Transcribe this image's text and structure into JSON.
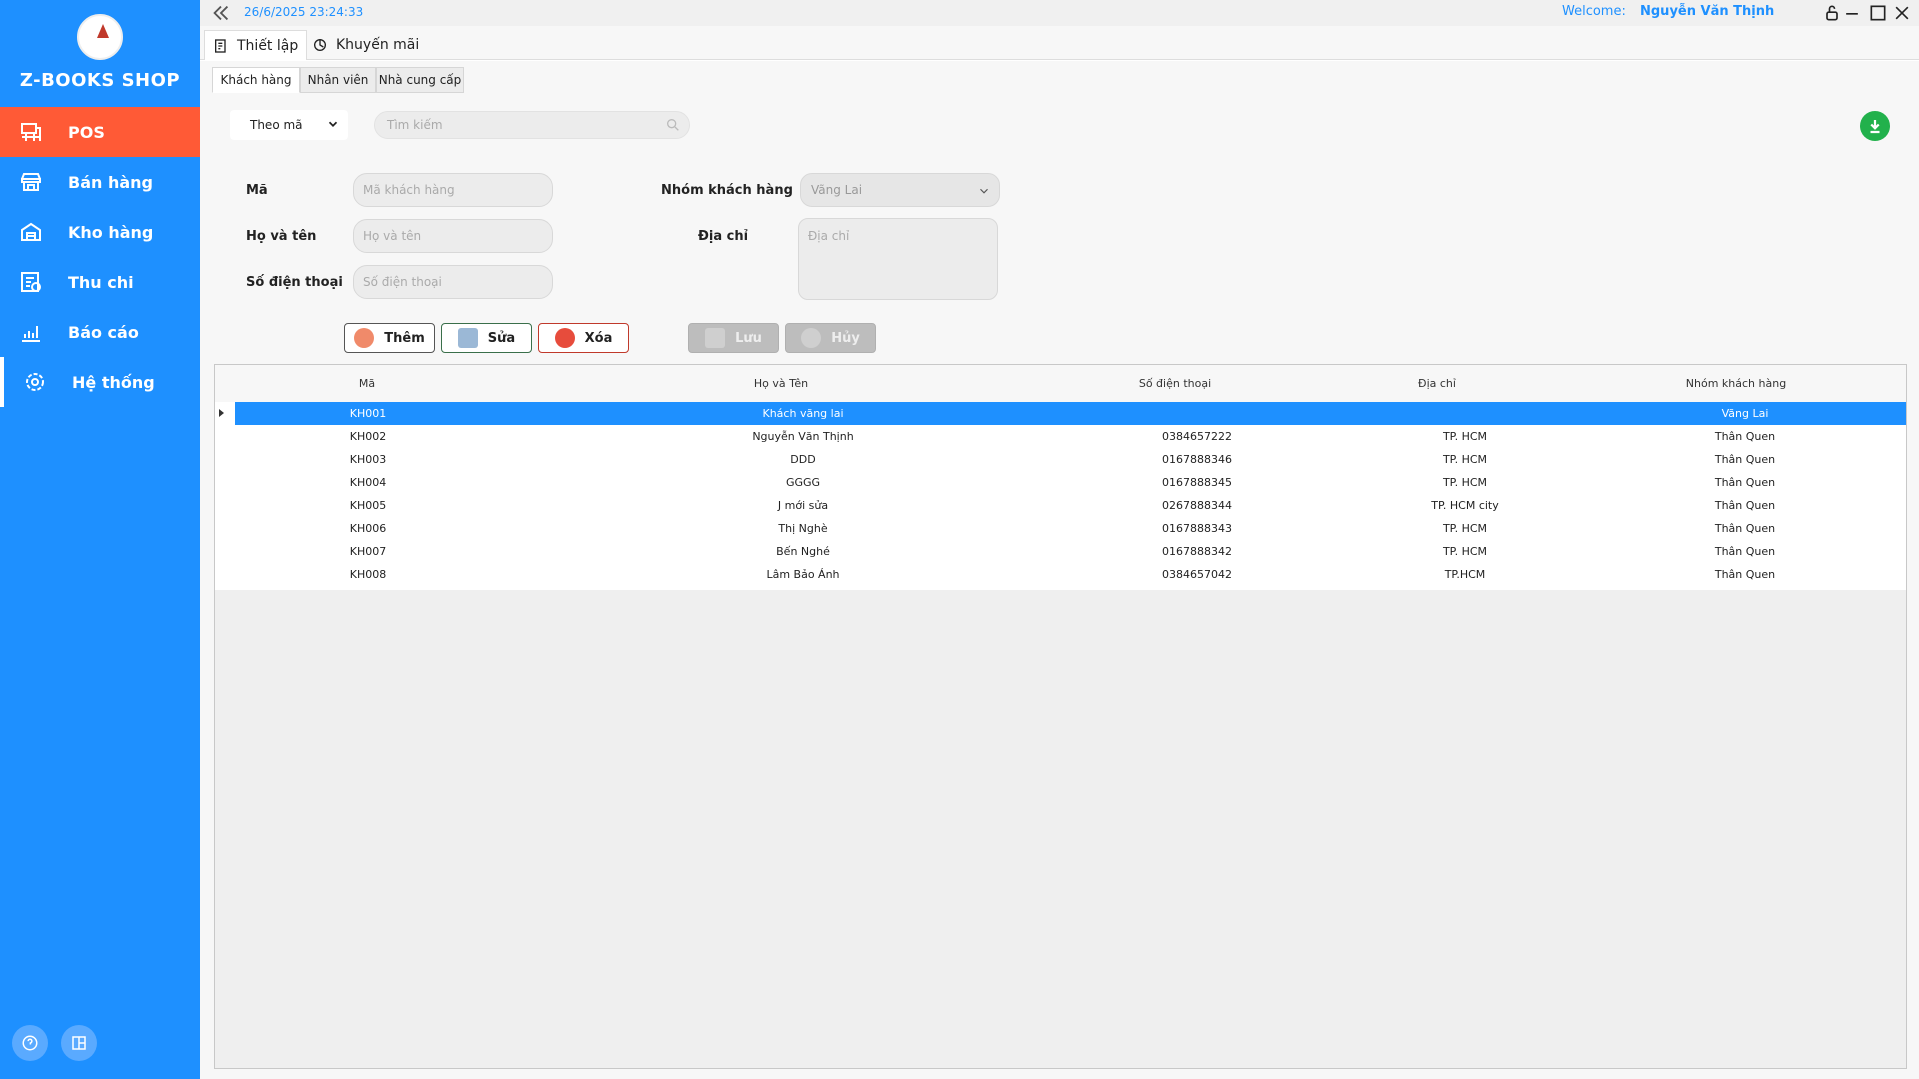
{
  "app": {
    "shop_name": "Z-BOOKS SHOP",
    "datetime": "26/6/2025 23:24:33",
    "welcome_label": "Welcome:",
    "user_name": "Nguyễn Văn Thịnh"
  },
  "colors": {
    "sidebar": "#1e90ff",
    "active_nav": "#ff5a36",
    "selected_row": "#1e90ff",
    "download": "#22b14c"
  },
  "sidebar": {
    "items": [
      {
        "label": "POS",
        "icon": "pos-icon"
      },
      {
        "label": "Bán hàng",
        "icon": "store-icon"
      },
      {
        "label": "Kho hàng",
        "icon": "warehouse-icon"
      },
      {
        "label": "Thu chi",
        "icon": "finance-icon"
      },
      {
        "label": "Báo cáo",
        "icon": "report-chart-icon"
      },
      {
        "label": "Hệ thống",
        "icon": "gear-icon"
      }
    ],
    "bottom": [
      "help-icon",
      "layout-icon"
    ]
  },
  "module_tabs": [
    {
      "label": "Thiết lập",
      "icon": "settings-doc-icon"
    },
    {
      "label": "Khuyến mãi",
      "icon": "promo-icon"
    }
  ],
  "sub_tabs": [
    "Khách hàng",
    "Nhân viên",
    "Nhà cung cấp"
  ],
  "filter": {
    "selected": "Theo mã",
    "search_placeholder": "Tìm kiếm"
  },
  "form": {
    "code_label": "Mã",
    "code_placeholder": "Mã khách hàng",
    "name_label": "Họ và tên",
    "name_placeholder": "Họ và tên",
    "phone_label": "Số điện thoại",
    "phone_placeholder": "Số điện thoại",
    "group_label": "Nhóm khách hàng",
    "group_value": "Vãng Lai",
    "address_label": "Địa chỉ",
    "address_placeholder": "Địa chỉ"
  },
  "buttons": {
    "add": "Thêm",
    "edit": "Sửa",
    "delete": "Xóa",
    "save": "Lưu",
    "cancel": "Hủy"
  },
  "table": {
    "columns": [
      "Mã",
      "Họ và Tên",
      "Số điện thoại",
      "Địa chỉ",
      "Nhóm khách hàng"
    ],
    "rows": [
      {
        "code": "KH001",
        "name": "Khách vãng lai",
        "phone": "",
        "address": "",
        "group": "Vãng Lai",
        "selected": true
      },
      {
        "code": "KH002",
        "name": "Nguyễn Văn Thịnh",
        "phone": "0384657222",
        "address": "TP. HCM",
        "group": "Thân Quen"
      },
      {
        "code": "KH003",
        "name": "DDD",
        "phone": "0167888346",
        "address": "TP. HCM",
        "group": "Thân Quen"
      },
      {
        "code": "KH004",
        "name": "GGGG",
        "phone": "0167888345",
        "address": "TP. HCM",
        "group": "Thân Quen"
      },
      {
        "code": "KH005",
        "name": "J mới sửa",
        "phone": "0267888344",
        "address": "TP. HCM city",
        "group": "Thân Quen"
      },
      {
        "code": "KH006",
        "name": "Thị Nghè",
        "phone": "0167888343",
        "address": "TP. HCM",
        "group": "Thân Quen"
      },
      {
        "code": "KH007",
        "name": "Bến Nghé",
        "phone": "0167888342",
        "address": "TP. HCM",
        "group": "Thân Quen"
      },
      {
        "code": "KH008",
        "name": "Lâm Bảo Ánh",
        "phone": "0384657042",
        "address": "TP.HCM",
        "group": "Thân Quen"
      }
    ]
  }
}
